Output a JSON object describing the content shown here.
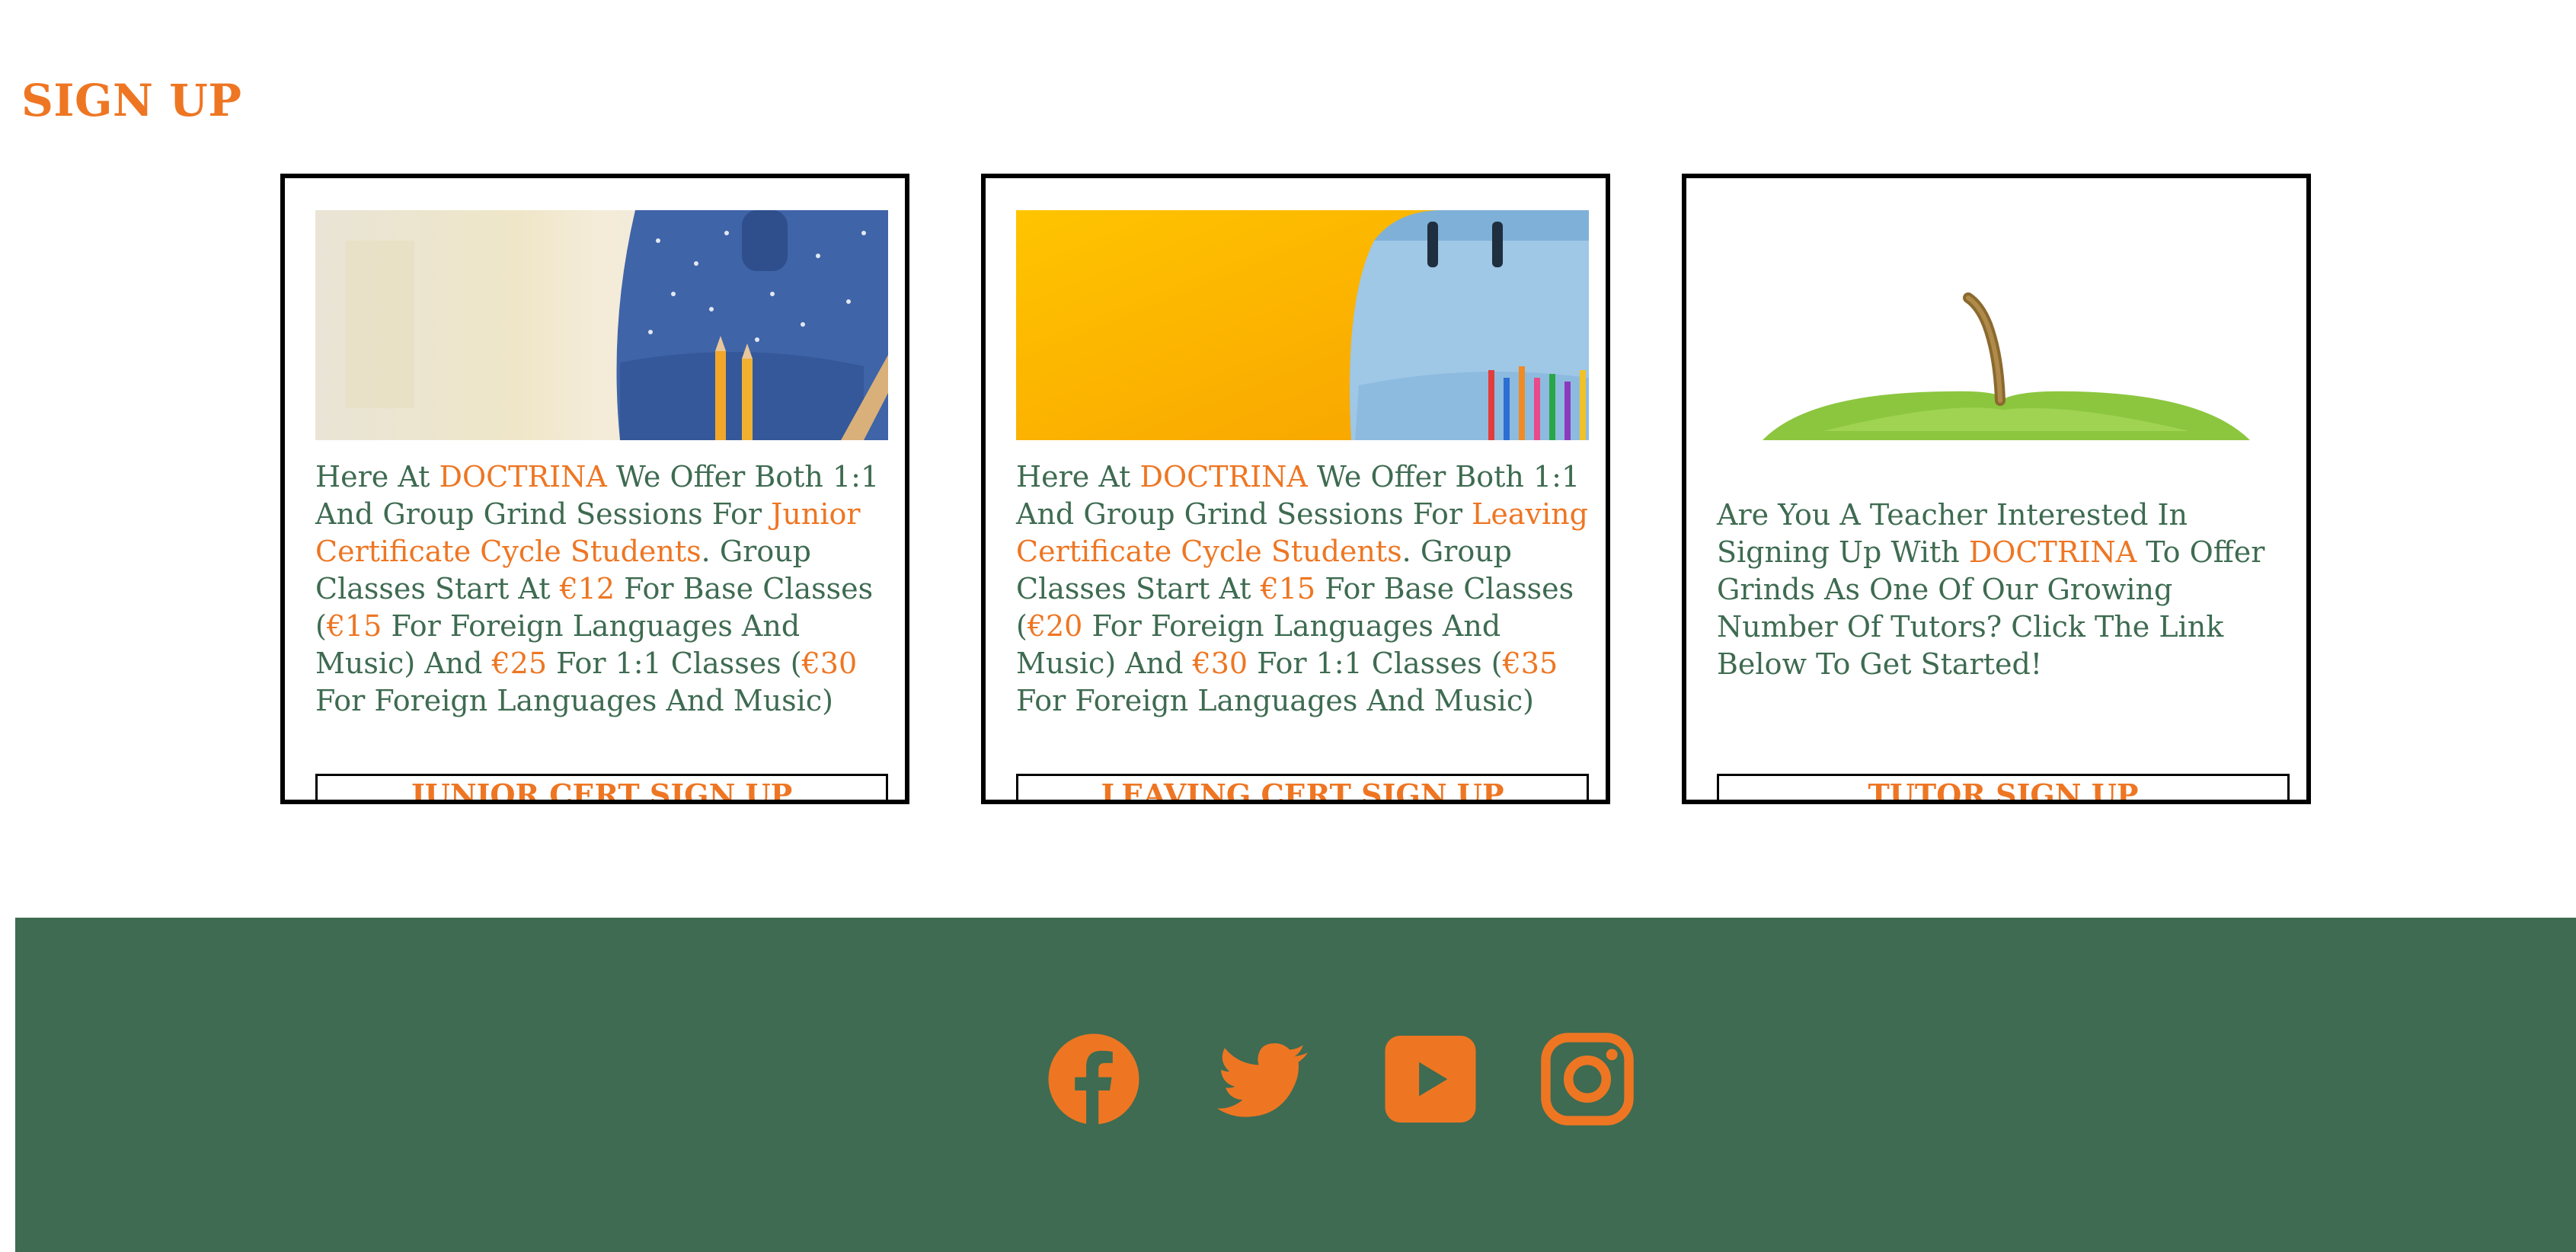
{
  "page": {
    "title": "SIGN UP"
  },
  "cards": [
    {
      "image_alt": "blue backpack with pencils",
      "text": {
        "p1": "Here At ",
        "brand": "DOCTRINA",
        "p2": " We Offer Both 1:1 And Group Grind Sessions For ",
        "audience": "Junior Certificate Cycle Students",
        "p3": ". Group Classes Start At ",
        "price_base": "€12",
        "p4": " For Base Classes (",
        "price_lang": "€15",
        "p5": " For Foreign Languages And Music) And ",
        "price_one": "€25",
        "p6": " For 1:1 Classes (",
        "price_one_lang": "€30",
        "p7": " For Foreign Languages And Music)"
      },
      "button": "JUNIOR CERT SIGN UP"
    },
    {
      "image_alt": "light blue backpack with colored pencils on yellow background",
      "text": {
        "p1": "Here At ",
        "brand": "DOCTRINA",
        "p2": " We Offer Both 1:1 And Group Grind Sessions For ",
        "audience": "Leaving Certificate Cycle Students",
        "p3": ". Group Classes Start At ",
        "price_base": "€15",
        "p4": " For Base Classes (",
        "price_lang": "€20",
        "p5": " For Foreign Languages And Music) And ",
        "price_one": "€30",
        "p6": " For 1:1 Classes (",
        "price_one_lang": "€35",
        "p7": " For Foreign Languages And Music)"
      },
      "button": "LEAVING CERT SIGN UP"
    },
    {
      "image_alt": "green apple stem",
      "text": {
        "p1": "Are You A Teacher Interested In Signing Up With ",
        "brand": "DOCTRINA",
        "p2": " To Offer Grinds As One Of Our Growing Number Of Tutors? Click The Link Below To Get Started!"
      },
      "button": "TUTOR SIGN UP"
    }
  ],
  "footer": {
    "social": [
      "facebook-icon",
      "twitter-icon",
      "youtube-icon",
      "instagram-icon"
    ]
  },
  "colors": {
    "accent": "#ee7623",
    "text": "#3e6b51",
    "footer_bg": "#3e6b51"
  }
}
